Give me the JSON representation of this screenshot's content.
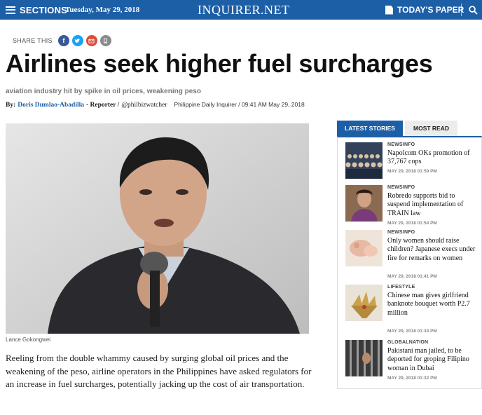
{
  "header": {
    "sections_label": "SECTIONS",
    "date": "Tuesday, May 29, 2018",
    "logo": "INQUIRER.NET",
    "todays_paper_label": "TODAY'S PAPER",
    "brand_color": "#1d5fa6"
  },
  "share": {
    "label": "SHARE THIS",
    "buttons": [
      "facebook-icon",
      "twitter-icon",
      "email-icon",
      "bookmark-icon"
    ]
  },
  "article": {
    "headline": "Airlines seek higher fuel surcharges",
    "dek": "aviation industry hit by spike in oil prices, weakening peso",
    "byline": {
      "by": "By:",
      "author": "Doris Dumlao-Abadilla",
      "role": "- Reporter /",
      "handle": "@philbizwatcher",
      "source": "Philippine Daily Inquirer / 09:41 AM May 29, 2018"
    },
    "photo_caption": "Lance Gokongwei",
    "body": "Reeling from the double whammy caused by surging global oil prices and the weakening of the peso, airline operators in the Philippines have asked regulators for an increase in fuel surcharges, potentially jacking up the cost of air transportation."
  },
  "sidebar": {
    "tabs": [
      "LATEST STORIES",
      "MOST READ"
    ],
    "active_tab": "LATEST STORIES",
    "stories": [
      {
        "category": "NEWSINFO",
        "title": "Napolcom OKs promotion of 37,767 cops",
        "time": "MAY 29, 2018 01:59 PM"
      },
      {
        "category": "NEWSINFO",
        "title": "Robredo supports bid to suspend implementation of TRAIN law",
        "time": "MAY 29, 2018 01:54 PM"
      },
      {
        "category": "NEWSINFO",
        "title": "Only women should raise children? Japanese execs under fire for remarks on women",
        "time": "MAY 29, 2018 01:41 PM"
      },
      {
        "category": "LIFESTYLE",
        "title": "Chinese man gives girlfriend banknote bouquet worth P2.7 million",
        "time": "MAY 29, 2018 01:34 PM"
      },
      {
        "category": "GLOBALNATION",
        "title": "Pakistani man jailed, to be deported for groping Filipino woman in Dubai",
        "time": "MAY 29, 2018 01:32 PM"
      }
    ]
  }
}
